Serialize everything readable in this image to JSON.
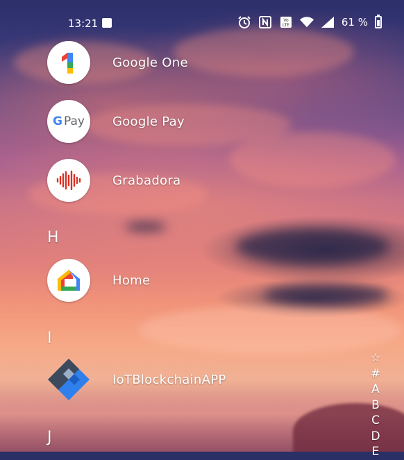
{
  "status_bar": {
    "time": "13:21",
    "battery_percent": "61 %",
    "battery_level": 0.61,
    "icons": [
      "gallery-icon",
      "alarm-icon",
      "nfc-icon",
      "volte-icon",
      "wifi-icon",
      "signal-icon",
      "battery-icon"
    ],
    "volte_text": "VoLTE"
  },
  "apps": [
    {
      "name": "Google One",
      "icon": "google-one-icon"
    },
    {
      "name": "Google Pay",
      "icon": "google-pay-icon",
      "icon_text_g": "G",
      "icon_text_pay": "Pay"
    },
    {
      "name": "Grabadora",
      "icon": "recorder-icon"
    },
    {
      "name": "Home",
      "icon": "google-home-icon"
    },
    {
      "name": "IoTBlockchainAPP",
      "icon": "iot-blockchain-icon"
    }
  ],
  "sections": {
    "h": "H",
    "i": "I",
    "j": "J"
  },
  "alphabet_index": [
    "☆",
    "#",
    "A",
    "B",
    "C",
    "D",
    "E"
  ],
  "colors": {
    "google_blue": "#4285F4",
    "google_red": "#EA4335",
    "google_yellow": "#FBBC04",
    "google_green": "#34A853",
    "recorder_red": "#D93025",
    "iot_dark": "#3C4A5C",
    "iot_blue": "#2F80ED"
  }
}
